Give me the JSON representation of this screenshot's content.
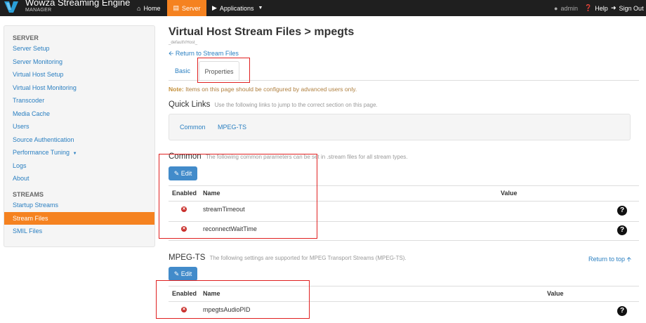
{
  "header": {
    "brand_title": "Wowza Streaming Engine",
    "brand_subtitle": "MANAGER",
    "nav_home": "Home",
    "nav_server": "Server",
    "nav_applications": "Applications",
    "nav_admin": "admin",
    "nav_help": "Help",
    "nav_signout": "Sign Out",
    "accent_color": "#f58220"
  },
  "sidebar": {
    "server_heading": "SERVER",
    "server_items": [
      "Server Setup",
      "Server Monitoring",
      "Virtual Host Setup",
      "Virtual Host Monitoring",
      "Transcoder",
      "Media Cache",
      "Users",
      "Source Authentication",
      "Performance Tuning",
      "Logs",
      "About"
    ],
    "streams_heading": "STREAMS",
    "streams_items": [
      "Startup Streams",
      "Stream Files",
      "SMIL Files"
    ],
    "active_item": "Stream Files"
  },
  "main": {
    "title": "Virtual Host Stream Files > mpegts",
    "vhost": "_defaultVHost_",
    "back_link": "Return to Stream Files",
    "tabs": [
      "Basic",
      "Properties"
    ],
    "active_tab": "Properties",
    "note_label": "Note:",
    "note_text": " Items on this page should be configured by advanced users only.",
    "quick_links": {
      "title": "Quick Links",
      "desc": "Use the following links to jump to the correct section on this page.",
      "links": [
        "Common",
        "MPEG-TS"
      ]
    },
    "common": {
      "title": "Common",
      "desc": "The following common parameters can be set in .stream files for all stream types.",
      "edit_label": "Edit",
      "columns": [
        "Enabled",
        "Name",
        "Value"
      ],
      "rows": [
        {
          "name": "streamTimeout",
          "enabled": false
        },
        {
          "name": "reconnectWaitTime",
          "enabled": false
        }
      ]
    },
    "mpegts": {
      "title": "MPEG-TS",
      "desc": "The following settings are supported for MPEG Transport Streams (MPEG-TS).",
      "return_top": "Return to top",
      "edit_label": "Edit",
      "columns": [
        "Enabled",
        "Name",
        "Value"
      ],
      "rows": [
        {
          "name": "mpegtsAudioPID",
          "enabled": false
        }
      ]
    }
  }
}
